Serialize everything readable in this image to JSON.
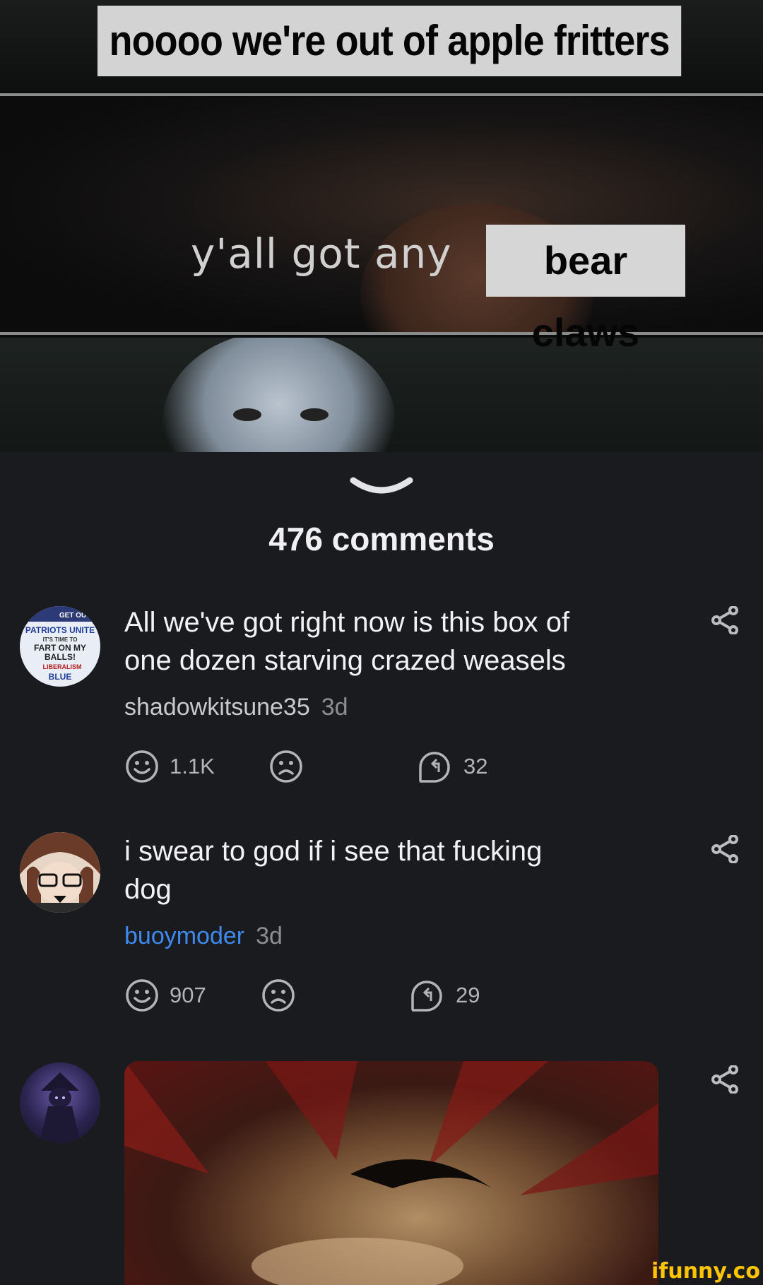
{
  "meme": {
    "caption_top": "noooo we're out of apple fritters",
    "caption_mid": "y'all got any",
    "caption_box": "bear claws"
  },
  "comments_header": {
    "count_label": "476 comments"
  },
  "comments": [
    {
      "text_line1": "All we've got right now is this box of",
      "text_line2": "one dozen starving crazed weasels",
      "user": "shadowkitsune35",
      "time": "3d",
      "likes": "1.1K",
      "replies": "32",
      "avatar_lines": [
        "GET OU",
        "PATRIOTS UNITE",
        "IT'S TIME TO",
        "FART ON MY",
        "BALLS!",
        "LIBERALISM",
        "BLUE"
      ]
    },
    {
      "text_line1": "i swear to god if i see that fucking",
      "text_line2": "dog",
      "user": "buoymoder",
      "time": "3d",
      "likes": "907",
      "replies": "29"
    }
  ],
  "watermark": "ifunny.co",
  "icons": {
    "collapse": "chevron-down-icon",
    "share": "share-icon",
    "smile": "smile-icon",
    "frown": "frown-icon",
    "reply": "reply-icon"
  },
  "colors": {
    "background": "#1a1b1f",
    "username_highlight": "#3f8af0",
    "watermark": "#ffc400"
  }
}
